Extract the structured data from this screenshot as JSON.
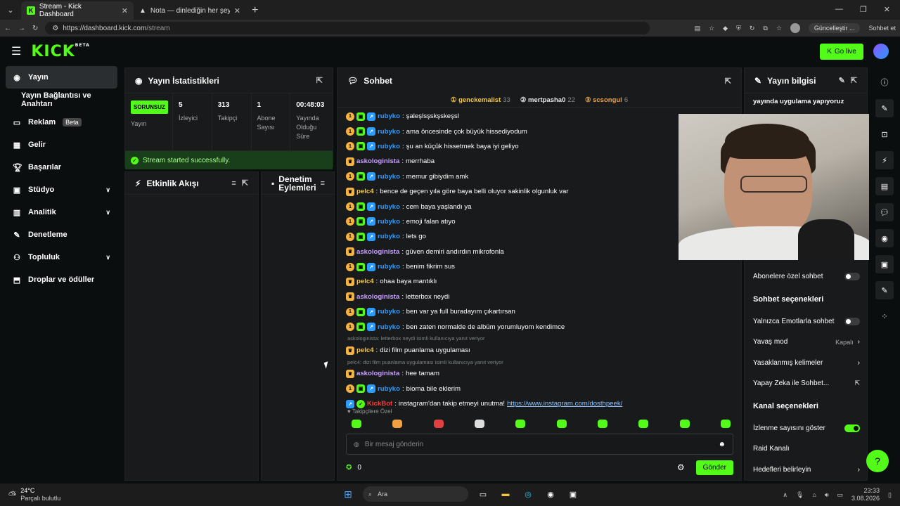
{
  "browser": {
    "tab1": "Stream - Kick Dashboard",
    "tab2": "Nota — dinlediğin her şeyi kaydet",
    "url_host": "https://dashboard.kick.com",
    "url_path": "/stream",
    "update": "Güncelleştir",
    "profile_menu": "...",
    "chat_btn": "Sohbet et"
  },
  "nav": {
    "logo": "KICK",
    "logo_sup": "BETA",
    "golive": "Go live"
  },
  "sidebar": {
    "items": [
      {
        "label": "Yayın",
        "icon": "broadcast-icon"
      },
      {
        "label": "Yayın Bağlantısı ve Anahtarı"
      },
      {
        "label": "Reklam",
        "badge": "Beta",
        "icon": "ads-icon"
      },
      {
        "label": "Gelir",
        "icon": "revenue-icon"
      },
      {
        "label": "Başarılar",
        "icon": "trophy-icon"
      },
      {
        "label": "Stüdyo",
        "icon": "studio-icon"
      },
      {
        "label": "Analitik",
        "icon": "analytics-icon"
      },
      {
        "label": "Denetleme",
        "icon": "wrench-icon"
      },
      {
        "label": "Topluluk",
        "icon": "community-icon"
      },
      {
        "label": "Droplar ve ödüller",
        "icon": "drops-icon"
      }
    ]
  },
  "stats": {
    "title": "Yayın İstatistikleri",
    "status": "SORUNSUZ",
    "status_label": "Yayın",
    "viewers": "5",
    "viewers_label": "İzleyici",
    "followers": "313",
    "followers_label": "Takipçi",
    "subs": "1",
    "subs_label": "Abone Sayısı",
    "uptime": "00:48:03",
    "uptime_label": "Yayında Olduğu Süre",
    "success": "Stream started successfully."
  },
  "activity": {
    "title": "Etkinlik Akışı"
  },
  "mod": {
    "title": "Denetim Eylemleri"
  },
  "chat": {
    "title": "Sohbet",
    "top": [
      {
        "name": "genckemalist",
        "n": "33"
      },
      {
        "name": "mertpasha0",
        "n": "22"
      },
      {
        "name": "scsongul",
        "n": "6"
      }
    ],
    "messages": [
      {
        "kind": "r",
        "user": "rubyko",
        "text": "şaleşlsşskşskeşsl"
      },
      {
        "kind": "r",
        "user": "rubyko",
        "text": "ama öncesinde çok büyük hissediyodum"
      },
      {
        "kind": "r",
        "user": "rubyko",
        "text": "şu an küçük hissetmek baya iyi geliyo"
      },
      {
        "kind": "a",
        "user": "askologinista",
        "text": "merrhaba"
      },
      {
        "kind": "r",
        "user": "rubyko",
        "text": "memur gibiydim amk"
      },
      {
        "kind": "p",
        "user": "pelc4",
        "text": "bence de geçen yıla göre baya belli oluyor sakinlik olgunluk var"
      },
      {
        "kind": "r",
        "user": "rubyko",
        "text": "cem baya yaşlandı ya"
      },
      {
        "kind": "r",
        "user": "rubyko",
        "text": "emoji falan atıyo"
      },
      {
        "kind": "r",
        "user": "rubyko",
        "text": "lets go"
      },
      {
        "kind": "a",
        "user": "askologinista",
        "text": "güven demiri andırdın mikrofonla"
      },
      {
        "kind": "r",
        "user": "rubyko",
        "text": "benim fikrim sus"
      },
      {
        "kind": "p",
        "user": "pelc4",
        "text": "ohaa baya mantıklı"
      },
      {
        "kind": "a",
        "user": "askologinista",
        "text": "letterbox neydi"
      },
      {
        "kind": "r",
        "user": "rubyko",
        "text": "ben var ya full buradayım çıkartırsan"
      },
      {
        "kind": "r",
        "user": "rubyko",
        "text": "ben zaten normalde de albüm yorumluyom kendimce"
      },
      {
        "kind": "reply",
        "text": "askologinista: letterbox neydi isimli kullanıcıya yanıt veriyor"
      },
      {
        "kind": "p",
        "user": "pelc4",
        "text": "dizi film puanlama uygulaması"
      },
      {
        "kind": "reply",
        "text": "pelc4: dizi film puanlama uygulaması isimli kullanıcıya yanıt veriyor"
      },
      {
        "kind": "a",
        "user": "askologinista",
        "text": "hee tamam"
      },
      {
        "kind": "r",
        "user": "rubyko",
        "text": "bioma bile eklerim"
      },
      {
        "kind": "bot",
        "user": "KickBot",
        "text": "instagram'dan takip etmeyi unutma!",
        "link": "https://www.instagram.com/dosthpeek/"
      }
    ],
    "followers_only": "Takipçilere Özel",
    "placeholder": "Bir mesaj gönderin",
    "points": "0",
    "send": "Gönder"
  },
  "info": {
    "title": "Yayın bilgisi",
    "stream_title": "yayında uygulama yapıyoruz",
    "subs_only": "Abonelere özel sohbet",
    "chat_opts": "Sohbet seçenekleri",
    "emote_only": "Yalnızca Emotlarla sohbet",
    "slow": "Yavaş mod",
    "slow_val": "Kapalı",
    "banned": "Yasaklanmış kelimeler",
    "ai": "Yapay Zeka ile Sohbet...",
    "channel_opts": "Kanal seçenekleri",
    "show_views": "İzlenme sayısını göster",
    "raid": "Raid Kanalı",
    "goals": "Hedefleri belirleyin"
  },
  "taskbar": {
    "temp": "24°C",
    "weather": "Parçalı bulutlu",
    "search": "Ara",
    "time": "23:33",
    "date": "3.08.2026"
  },
  "colors": {
    "brand": "#53fc18",
    "bg": "#0b0e0f",
    "panel": "#181a1b",
    "rubyko": "#2a9bff",
    "askologinista": "#c8a0ff",
    "pelc4": "#f6c744",
    "kickbot": "#ff3a3a"
  }
}
